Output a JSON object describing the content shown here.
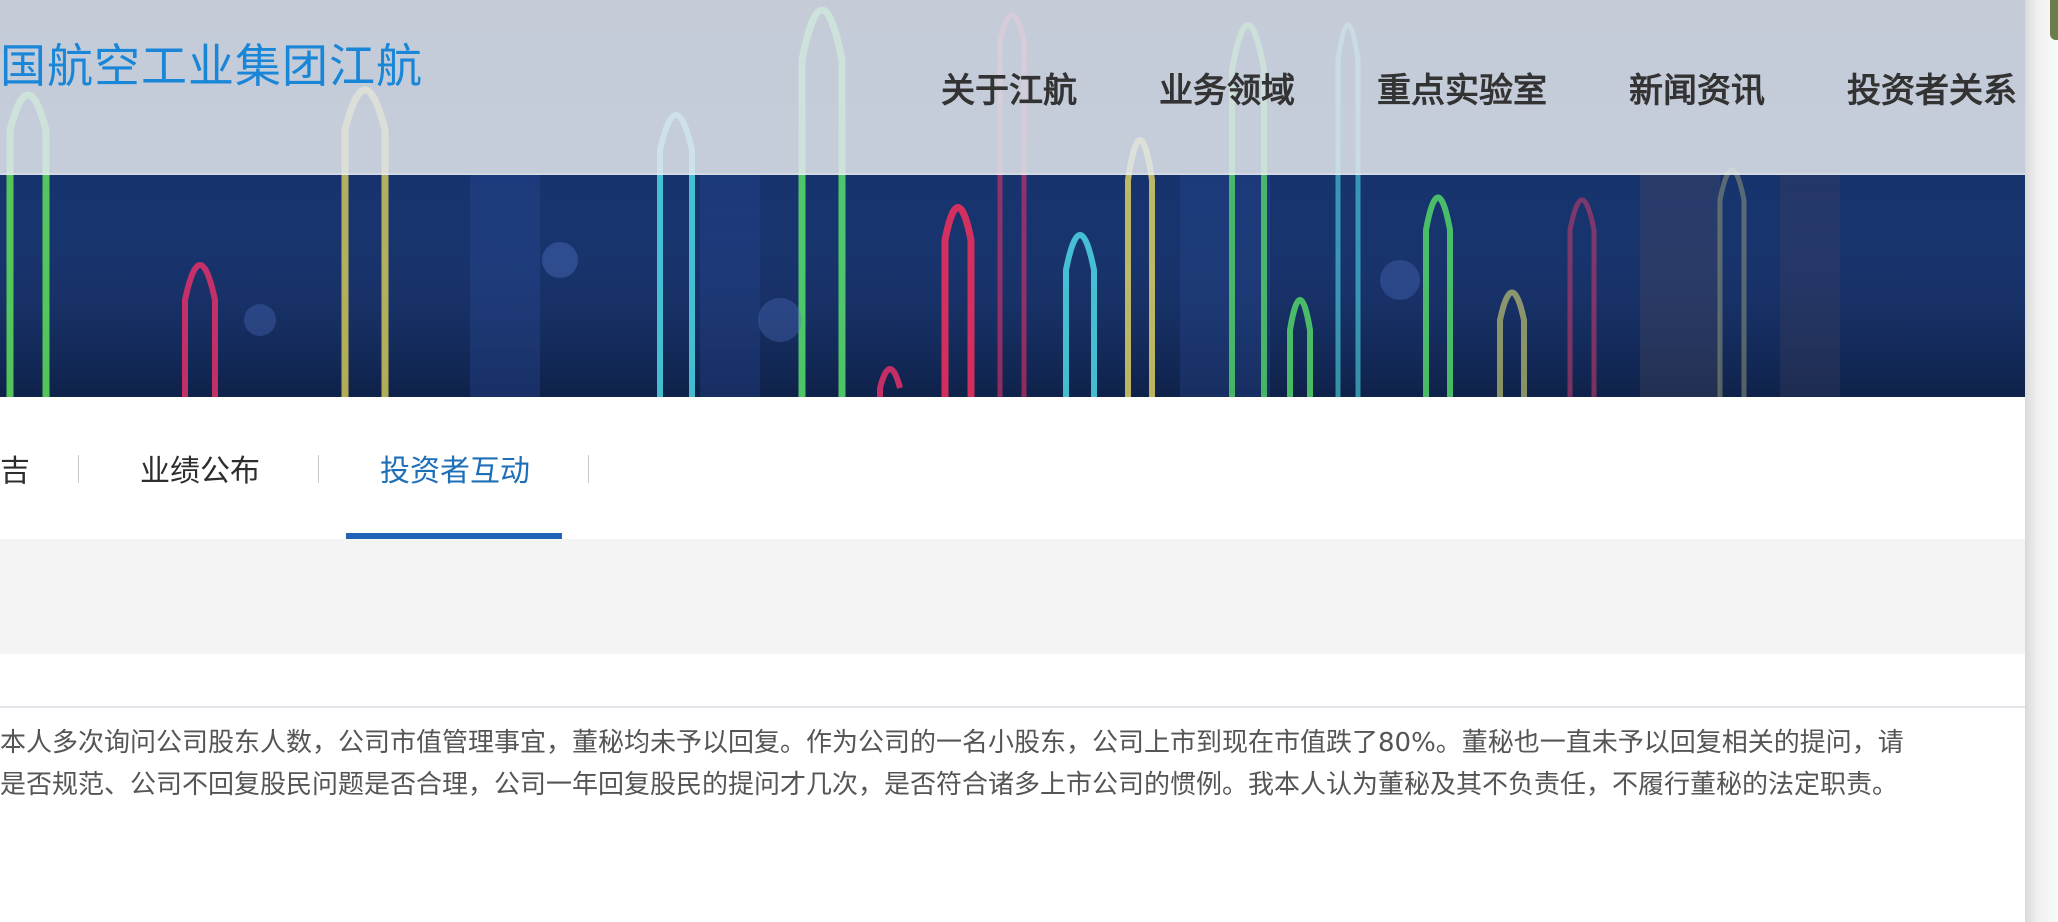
{
  "header": {
    "brand": "国航空工业集团江航",
    "nav": [
      "关于江航",
      "业务领域",
      "重点实验室",
      "新闻资讯",
      "投资者关系"
    ]
  },
  "subnav": {
    "tabs": [
      "吉",
      "业绩公布",
      "投资者互动"
    ],
    "active": "投资者互动"
  },
  "content": {
    "line1": "本人多次询问公司股东人数，公司市值管理事宜，董秘均未予以回复。作为公司的一名小股东，公司上市到现在市值跌了80%。董秘也一直未予以回复相关的提问，请",
    "line2": "是否规范、公司不回复股民问题是否合理，公司一年回复股民的提问才几次，是否符合诸多上市公司的惯例。我本人认为董秘及其不负责任，不履行董秘的法定职责。"
  },
  "colors": {
    "brand": "#1a86d8",
    "active_tab": "#1f6fb8",
    "underline": "#1f63b5"
  }
}
